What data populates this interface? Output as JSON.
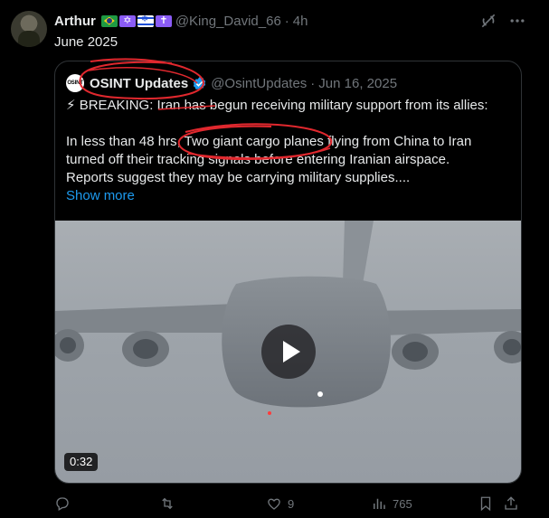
{
  "post": {
    "author_name": "Arthur",
    "handle": "@King_David_66",
    "separator": "·",
    "time": "4h",
    "text": "June 2025",
    "icons": [
      "brazil-flag-icon",
      "star-of-david-icon",
      "israel-flag-icon",
      "latin-cross-icon",
      "grok-icon",
      "more-icon"
    ]
  },
  "quote": {
    "avatar_text": "OSINT",
    "name": "OSINT Updates",
    "handle": "@OsintUpdates",
    "separator": "·",
    "date": "Jun 16, 2025",
    "line1": "⚡ BREAKING: Iran has begun receiving military support from its allies:",
    "line2": "In less than 48 hrs, Two giant cargo planes flying from China to Iran",
    "line3": "turned off their tracking signals before entering Iranian airspace.",
    "line4": "Reports suggest they may be carrying military supplies....",
    "show_more": "Show more",
    "video_duration": "0:32",
    "verified_color": "#1d9bf0"
  },
  "actions": {
    "reply_count": "",
    "repost_count": "",
    "like_count": "9",
    "views_count": "765"
  },
  "colors": {
    "background": "#000000",
    "text": "#e7e9ea",
    "muted": "#71767b",
    "accent": "#1d9bf0",
    "annotation": "#e0282e"
  }
}
